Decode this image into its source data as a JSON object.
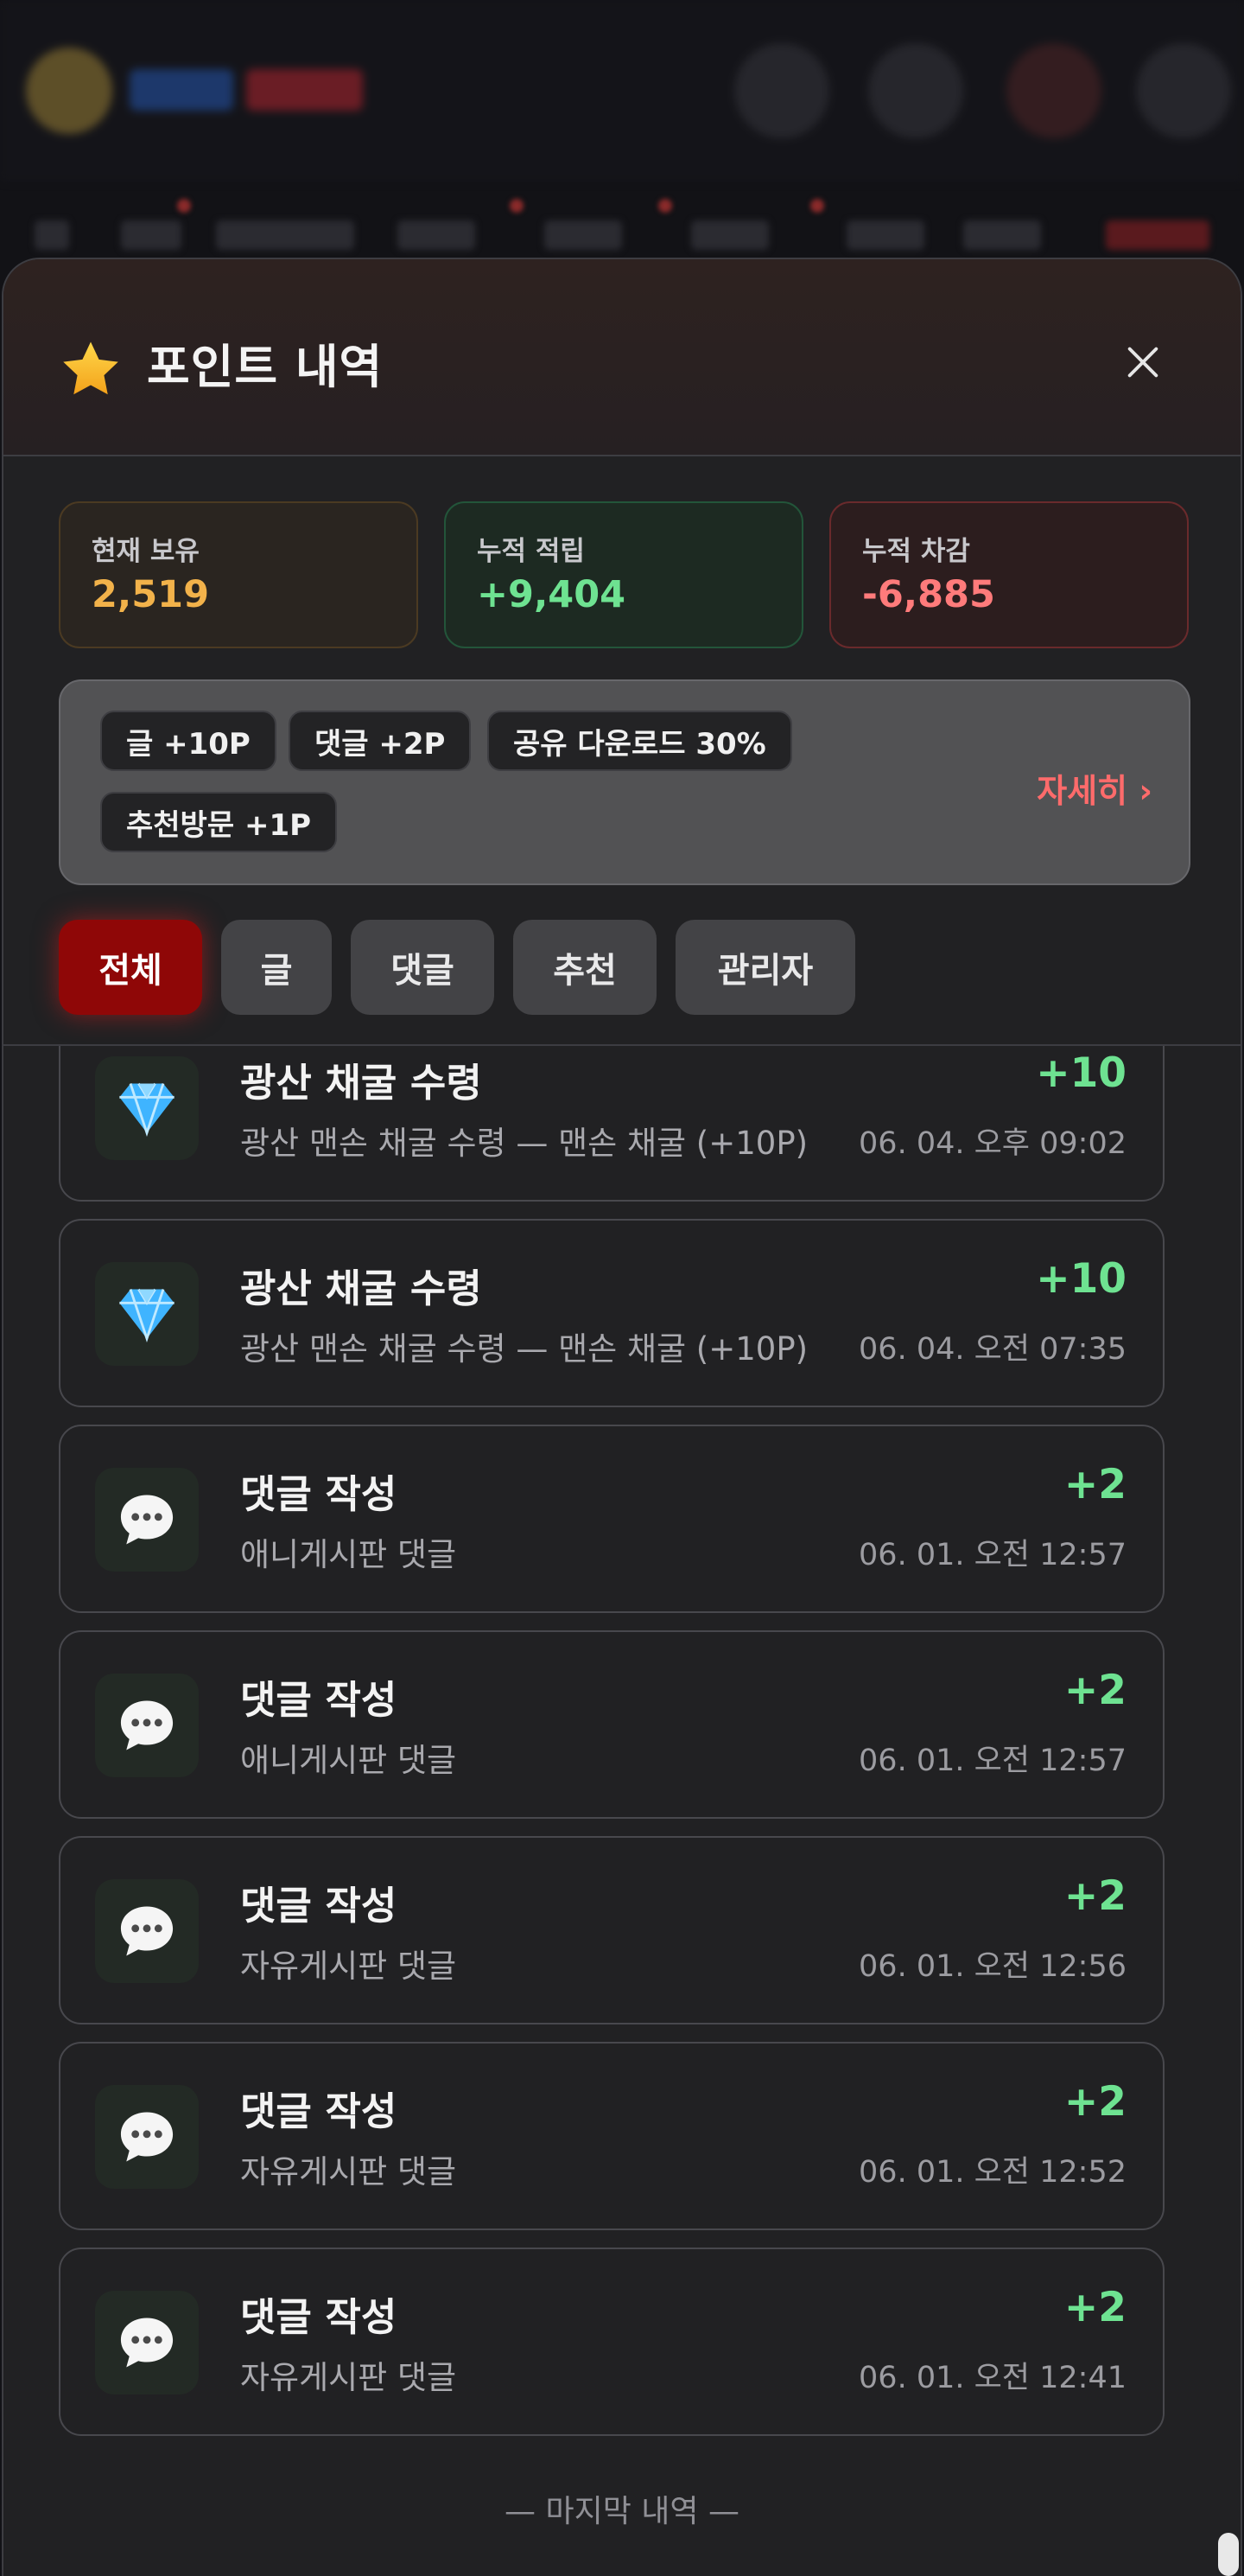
{
  "modal": {
    "title": "포인트 내역",
    "star_icon": "star-icon",
    "close_icon": "close-icon"
  },
  "stats": {
    "hold": {
      "label": "현재 보유",
      "value": "2,519"
    },
    "earned": {
      "label": "누적 적립",
      "value": "+9,404"
    },
    "spent": {
      "label": "누적 차감",
      "value": "-6,885"
    }
  },
  "rules": {
    "chips": [
      "글 +10P",
      "댓글 +2P",
      "공유 다운로드 30%",
      "추천방문 +1P"
    ],
    "detail_link": "자세히 ›"
  },
  "tabs": [
    {
      "label": "전체",
      "active": true
    },
    {
      "label": "글",
      "active": false
    },
    {
      "label": "댓글",
      "active": false
    },
    {
      "label": "추천",
      "active": false
    },
    {
      "label": "관리자",
      "active": false
    }
  ],
  "entries": [
    {
      "icon": "gem-icon",
      "title": "광산 채굴 수령",
      "desc": "광산 맨손 채굴 수령 — 맨손 채굴 (+10P)",
      "amount": "+10",
      "date": "06. 04. 오후 09:02"
    },
    {
      "icon": "gem-icon",
      "title": "광산 채굴 수령",
      "desc": "광산 맨손 채굴 수령 — 맨손 채굴 (+10P)",
      "amount": "+10",
      "date": "06. 04. 오전 07:35"
    },
    {
      "icon": "speech-bubble-icon",
      "title": "댓글 작성",
      "desc": "애니게시판 댓글",
      "amount": "+2",
      "date": "06. 01. 오전 12:57"
    },
    {
      "icon": "speech-bubble-icon",
      "title": "댓글 작성",
      "desc": "애니게시판 댓글",
      "amount": "+2",
      "date": "06. 01. 오전 12:57"
    },
    {
      "icon": "speech-bubble-icon",
      "title": "댓글 작성",
      "desc": "자유게시판 댓글",
      "amount": "+2",
      "date": "06. 01. 오전 12:56"
    },
    {
      "icon": "speech-bubble-icon",
      "title": "댓글 작성",
      "desc": "자유게시판 댓글",
      "amount": "+2",
      "date": "06. 01. 오전 12:52"
    },
    {
      "icon": "speech-bubble-icon",
      "title": "댓글 작성",
      "desc": "자유게시판 댓글",
      "amount": "+2",
      "date": "06. 01. 오전 12:41"
    }
  ],
  "end_marker": "— 마지막 내역 —",
  "colors": {
    "accent_red": "#8f0707",
    "positive": "#6ee291",
    "negative": "#ff7b7b",
    "hold": "#f2b24a"
  }
}
